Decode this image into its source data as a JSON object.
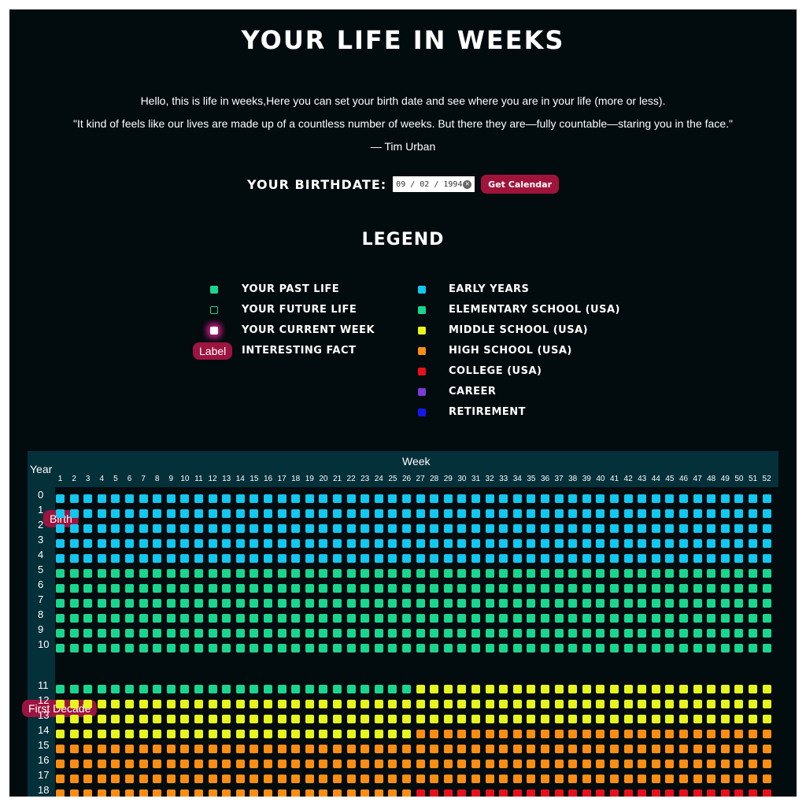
{
  "title": "Your Life in Weeks",
  "intro": {
    "line1": "Hello, this is life in weeks,Here you can set your birth date and see where you are in your life (more or less).",
    "quote": "\"It kind of feels like our lives are made up of a countless number of weeks. But there they are—fully countable—staring you in the face.\"",
    "author": "— Tim Urban"
  },
  "birthdate": {
    "label": "Your Birthdate:",
    "value": "09 / 02 / 1994",
    "clear_icon": "clear-icon",
    "button": "Get Calendar"
  },
  "legend": {
    "title": "Legend",
    "left": [
      {
        "label": "Your Past Life",
        "kind": "past",
        "color": "#19d68f"
      },
      {
        "label": "Your Future Life",
        "kind": "future",
        "color": "#19d68f"
      },
      {
        "label": "Your Current Week",
        "kind": "current",
        "color": "#ffffff"
      },
      {
        "label": "Interesting Fact",
        "kind": "fact",
        "pill": "Label"
      }
    ],
    "right": [
      {
        "label": "Early Years",
        "color": "#10c8f0"
      },
      {
        "label": "Elementary School (USA)",
        "color": "#19d68f"
      },
      {
        "label": "Middle School (USA)",
        "color": "#e6f51c"
      },
      {
        "label": "High School (USA)",
        "color": "#fb8e12"
      },
      {
        "label": "College (USA)",
        "color": "#e8101a"
      },
      {
        "label": "Career",
        "color": "#7a3bd6"
      },
      {
        "label": "Retirement",
        "color": "#1418f0"
      }
    ]
  },
  "grid": {
    "year_heading": "Year",
    "week_heading": "Week",
    "weeks": [
      "1",
      "2",
      "3",
      "4",
      "5",
      "6",
      "7",
      "8",
      "9",
      "10",
      "11",
      "12",
      "13",
      "14",
      "15",
      "16",
      "17",
      "18",
      "19",
      "20",
      "21",
      "22",
      "23",
      "24",
      "25",
      "26",
      "27",
      "28",
      "29",
      "30",
      "31",
      "32",
      "33",
      "34",
      "35",
      "36",
      "37",
      "38",
      "39",
      "40",
      "41",
      "42",
      "43",
      "44",
      "45",
      "46",
      "47",
      "48",
      "49",
      "50",
      "51",
      "52"
    ],
    "years": [
      "0",
      "1",
      "2",
      "3",
      "4",
      "5",
      "6",
      "7",
      "8",
      "9",
      "10",
      "11",
      "12",
      "13",
      "14",
      "15",
      "16",
      "17",
      "18"
    ],
    "phase_colors": {
      "early": "#10c8f0",
      "elementary": "#19d68f",
      "middle": "#e6f51c",
      "high": "#fb8e12",
      "college": "#e8101a"
    },
    "fact_labels": {
      "birth": "Birth",
      "first_decade": "First Decade"
    }
  }
}
